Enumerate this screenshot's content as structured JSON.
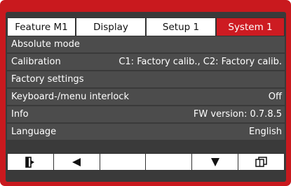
{
  "tabs": [
    {
      "label": "Feature  M1",
      "active": false
    },
    {
      "label": "Display",
      "active": false
    },
    {
      "label": "Setup 1",
      "active": false
    },
    {
      "label": "System 1",
      "active": true
    }
  ],
  "menu": {
    "items": [
      {
        "label": "Absolute mode",
        "value": ""
      },
      {
        "label": "Calibration",
        "value": "C1: Factory calib., C2: Factory calib."
      },
      {
        "label": "Factory settings",
        "value": ""
      },
      {
        "label": "Keyboard-/menu interlock",
        "value": "Off"
      },
      {
        "label": "Info",
        "value": "FW version: 0.7.8.5"
      },
      {
        "label": "Language",
        "value": "English"
      }
    ]
  },
  "softkeys": [
    {
      "icon": "exit-icon",
      "glyph": "⍈"
    },
    {
      "icon": "arrow-left-icon",
      "glyph": "◀"
    },
    {
      "icon": "blank",
      "glyph": ""
    },
    {
      "icon": "blank",
      "glyph": ""
    },
    {
      "icon": "arrow-down-icon",
      "glyph": "▼"
    },
    {
      "icon": "pages-icon",
      "glyph": "◫"
    }
  ],
  "colors": {
    "frame": "#c9191e",
    "active_tab": "#cd1b22",
    "screen_bg": "#3a3a3a",
    "row_bg": "#4c4c4c"
  }
}
